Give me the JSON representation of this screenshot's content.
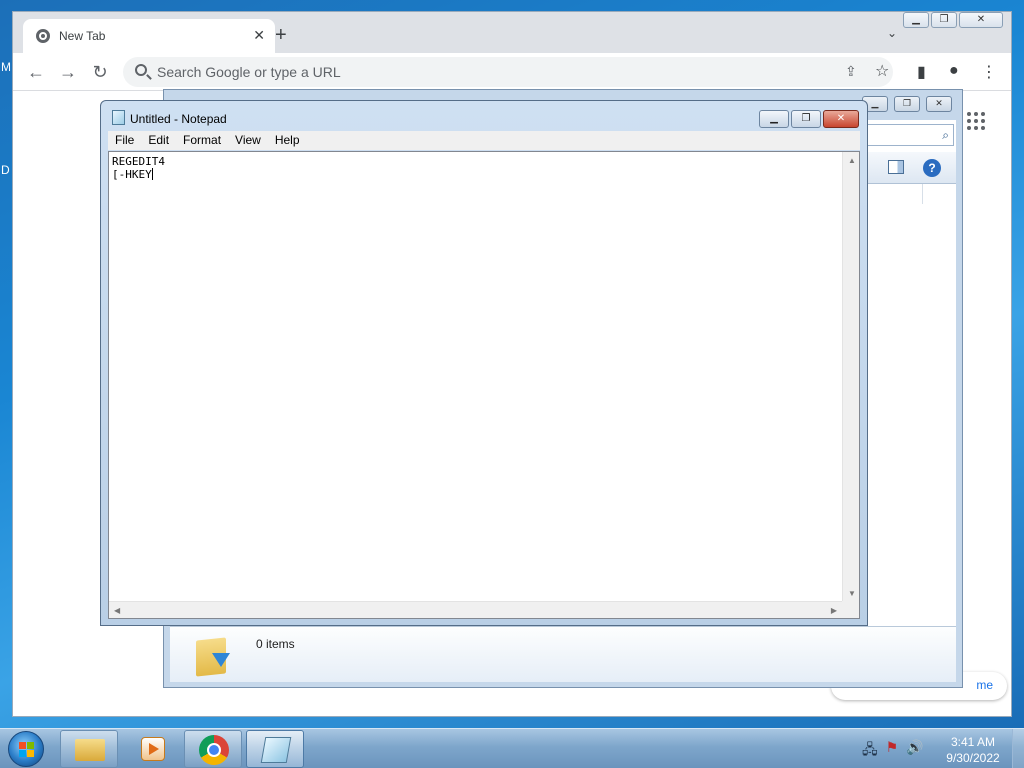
{
  "desktop": {
    "edge_letters": [
      "M",
      "D"
    ]
  },
  "chrome": {
    "tab_title": "New Tab",
    "tab_close": "✕",
    "new_tab": "+",
    "tab_search": "⌄",
    "omnibox_placeholder": "Search Google or type a URL",
    "customize_label": "me",
    "window_controls": {
      "minimize": "▁",
      "restore": "❐",
      "close": "✕"
    },
    "nav": {
      "back": "←",
      "forward": "→",
      "reload": "↻"
    },
    "toolbar_icons": {
      "share": "⇪",
      "star": "☆",
      "side_panel": "▮",
      "profile": "●",
      "menu": "⋮"
    }
  },
  "explorer": {
    "items_count": "0 items",
    "search_icon": "⌕",
    "help_icon": "?",
    "window_controls": {
      "minimize": "▁",
      "restore": "❐",
      "close": "✕"
    }
  },
  "notepad": {
    "title": "Untitled - Notepad",
    "menu": [
      "File",
      "Edit",
      "Format",
      "View",
      "Help"
    ],
    "content": "REGEDIT4\n[-HKEY",
    "window_controls": {
      "minimize": "▁",
      "restore": "❐",
      "close": "✕"
    }
  },
  "taskbar": {
    "clock_time": "3:41 AM",
    "clock_date": "9/30/2022",
    "tray_icons": [
      "network-icon",
      "action-center-flag-icon",
      "volume-icon"
    ],
    "tray_glyphs": [
      "🖧",
      "⚑",
      "🔊"
    ],
    "pinned": [
      "windows-explorer",
      "media-player",
      "google-chrome",
      "notepad"
    ]
  },
  "colors": {
    "desktop_blue": "#1a86d3",
    "chrome_bar": "#dee1e6",
    "notepad_close_red": "#c8452f",
    "start_flag": [
      "#f25022",
      "#7fba00",
      "#00a4ef",
      "#ffb900"
    ]
  }
}
